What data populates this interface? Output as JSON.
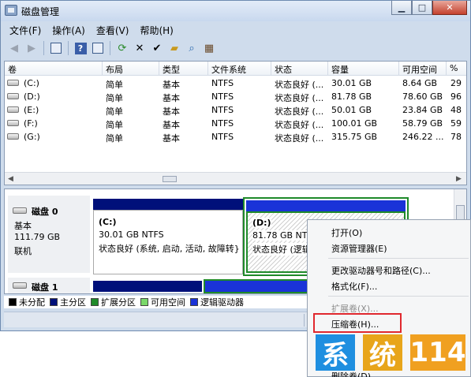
{
  "window": {
    "title": "磁盘管理",
    "controls": [
      "minimize",
      "maximize",
      "close"
    ]
  },
  "menu": [
    "文件(F)",
    "操作(A)",
    "查看(V)",
    "帮助(H)"
  ],
  "toolbar_icons": [
    "back-arrow-icon",
    "forward-arrow-icon",
    "console-tree-icon",
    "help-icon",
    "properties-icon",
    "refresh-icon",
    "delete-icon",
    "check-icon",
    "open-folder-icon",
    "find-icon",
    "disk-properties-icon"
  ],
  "volume_table": {
    "columns": [
      "卷",
      "布局",
      "类型",
      "文件系统",
      "状态",
      "容量",
      "可用空间",
      "%"
    ],
    "rows": [
      [
        "(C:)",
        "简单",
        "基本",
        "NTFS",
        "状态良好 (...",
        "30.01 GB",
        "8.64 GB",
        "29"
      ],
      [
        "(D:)",
        "简单",
        "基本",
        "NTFS",
        "状态良好 (...",
        "81.78 GB",
        "78.60 GB",
        "96"
      ],
      [
        "(E:)",
        "简单",
        "基本",
        "NTFS",
        "状态良好 (...",
        "50.01 GB",
        "23.84 GB",
        "48"
      ],
      [
        "(F:)",
        "简单",
        "基本",
        "NTFS",
        "状态良好 (...",
        "100.01 GB",
        "58.79 GB",
        "59"
      ],
      [
        "(G:)",
        "简单",
        "基本",
        "NTFS",
        "状态良好 (...",
        "315.75 GB",
        "246.22 ...",
        "78"
      ]
    ]
  },
  "disk0": {
    "name": "磁盘 0",
    "type": "基本",
    "size": "111.79 GB",
    "status": "联机",
    "partC": {
      "label": "(C:)",
      "size": "30.01 GB NTFS",
      "status": "状态良好 (系统, 启动, 活动, 故障转}"
    },
    "partD": {
      "label": "(D:)",
      "size": "81.78 GB NTF",
      "status": "状态良好 (逻辑"
    }
  },
  "disk1": {
    "name": "磁盘 1"
  },
  "legend": [
    {
      "label": "未分配",
      "color": "#000000"
    },
    {
      "label": "主分区",
      "color": "#00107a"
    },
    {
      "label": "扩展分区",
      "color": "#1f8a2a"
    },
    {
      "label": "可用空间",
      "color": "#7ad86a"
    },
    {
      "label": "逻辑驱动器",
      "color": "#1a33d8"
    }
  ],
  "context_menu": {
    "items": [
      {
        "label": "打开(O)",
        "enabled": true
      },
      {
        "label": "资源管理器(E)",
        "enabled": true
      },
      {
        "label": "更改驱动器号和路径(C)...",
        "enabled": true
      },
      {
        "label": "格式化(F)...",
        "enabled": true
      },
      {
        "label": "扩展卷(X)...",
        "enabled": false
      },
      {
        "label": "压缩卷(H)...",
        "enabled": true,
        "highlighted": true
      },
      {
        "label": "删除卷(D)...",
        "enabled": true
      }
    ]
  },
  "watermark": {
    "chars": [
      "系",
      "统",
      "114"
    ],
    "colors": [
      "#1f8fe0",
      "#e8a51a",
      "#f0a020"
    ]
  }
}
